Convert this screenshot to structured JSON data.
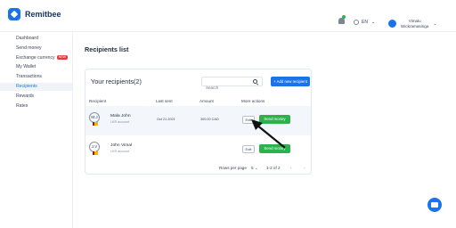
{
  "app": {
    "name": "Remitbee"
  },
  "header": {
    "language": "EN",
    "user_name_line1": "Vimalu",
    "user_name_line2": "Wickramasinga"
  },
  "sidebar": {
    "items": [
      {
        "label": "Dashboard"
      },
      {
        "label": "Send money"
      },
      {
        "label": "Exchange currency",
        "badge": "NEW"
      },
      {
        "label": "My Wallet"
      },
      {
        "label": "Transactions"
      },
      {
        "label": "Recipients",
        "active": true
      },
      {
        "label": "Rewards"
      },
      {
        "label": "Rates"
      }
    ]
  },
  "main": {
    "title": "Recipients list",
    "card_title": "Your recipients(2)",
    "search_placeholder": "Search",
    "add_button": "+ Add new recipient",
    "columns": [
      "Recipient",
      "Last sent",
      "Amount",
      "More actions"
    ],
    "rows": [
      {
        "initials": "M.J",
        "name": "Mala John",
        "type": "LKR account",
        "last_sent": "Oct 21 2021",
        "amount": "300.00 CAD",
        "edit": "Edit",
        "send": "Send money"
      },
      {
        "initials": "J.V",
        "name": "John Vimal",
        "type": "LKR account",
        "last_sent": "",
        "amount": "",
        "edit": "Edit",
        "send": "Send money"
      }
    ],
    "pagination": {
      "rows_per_page_label": "Rows per page",
      "rows_per_page": "5",
      "range": "1-2 of 2"
    }
  },
  "colors": {
    "accent": "#1a73e8",
    "success": "#2bb24c",
    "active_row": "#f3f6fb"
  },
  "icons": [
    "bell-icon",
    "globe-icon",
    "user-avatar-icon",
    "search-icon",
    "chat-icon",
    "arrow-annotation"
  ]
}
